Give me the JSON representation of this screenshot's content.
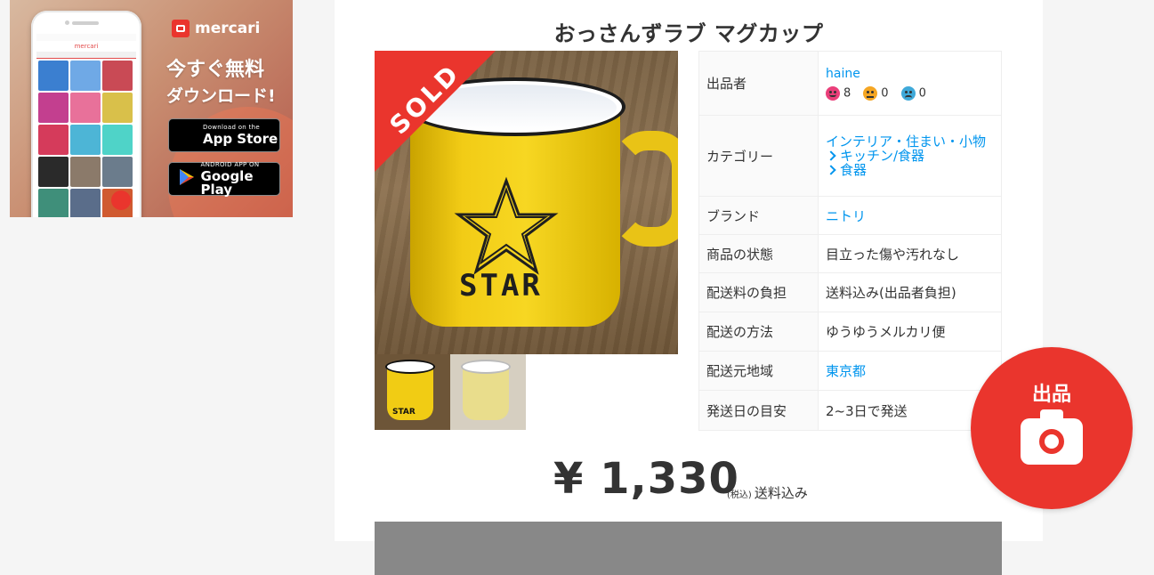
{
  "banner": {
    "brand": "mercari",
    "promo_line1": "今すぐ無料",
    "promo_line2": "ダウンロード!",
    "app_store": {
      "small": "Download on the",
      "big": "App Store"
    },
    "google_play": {
      "small": "ANDROID APP ON",
      "big": "Google Play"
    },
    "phone_app_logo": "mercari"
  },
  "item": {
    "title": "おっさんずラブ マグカップ",
    "sold_label": "SOLD",
    "mug_text": "STAR",
    "thumb1_text": "STAR"
  },
  "details": {
    "seller": {
      "key": "出品者",
      "name": "haine",
      "good": "8",
      "normal": "0",
      "bad": "0"
    },
    "category": {
      "key": "カテゴリー",
      "main": "インテリア・住まい・小物",
      "sub1": "キッチン/食器",
      "sub2": "食器"
    },
    "brand": {
      "key": "ブランド",
      "value": "ニトリ"
    },
    "condition": {
      "key": "商品の状態",
      "value": "目立った傷や汚れなし"
    },
    "shipping_fee": {
      "key": "配送料の負担",
      "value": "送料込み(出品者負担)"
    },
    "shipping_method": {
      "key": "配送の方法",
      "value": "ゆうゆうメルカリ便"
    },
    "ship_from": {
      "key": "配送元地域",
      "value": "東京都"
    },
    "ship_days": {
      "key": "発送日の目安",
      "value": "2~3日で発送"
    }
  },
  "price": {
    "amount": "¥ 1,330",
    "tax_label": "(税込)",
    "shipping_note": "送料込み"
  },
  "sell_button": {
    "label": "出品"
  },
  "colors": {
    "accent": "#ea352d",
    "link": "#0095ee",
    "good": "#ea3f7a",
    "normal": "#f5a623",
    "bad": "#3fa9d9"
  }
}
